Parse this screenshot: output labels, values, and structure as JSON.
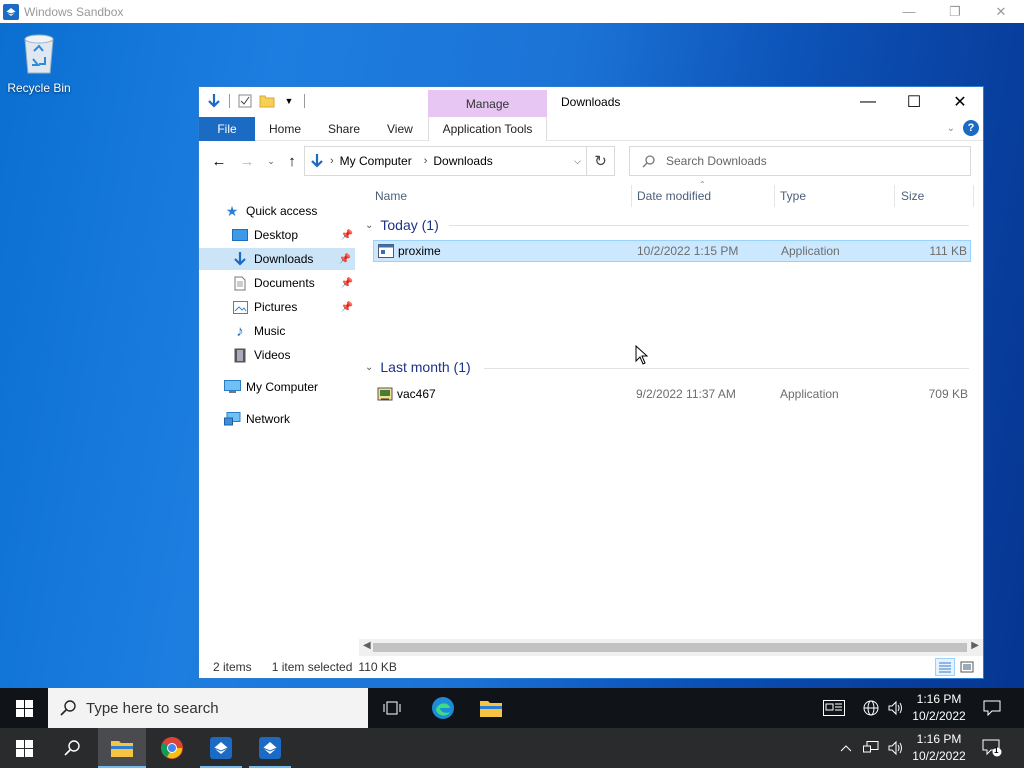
{
  "sandbox": {
    "title": "Windows Sandbox"
  },
  "desktop": {
    "recycle_bin_label": "Recycle Bin"
  },
  "explorer": {
    "title": "Downloads",
    "context_tab": "Manage",
    "ribbon_tabs": [
      "File",
      "Home",
      "Share",
      "View",
      "Application Tools"
    ],
    "breadcrumb": [
      "My Computer",
      "Downloads"
    ],
    "search_placeholder": "Search Downloads",
    "nav": {
      "quick_access": "Quick access",
      "items": [
        "Desktop",
        "Downloads",
        "Documents",
        "Pictures",
        "Music",
        "Videos"
      ],
      "my_computer": "My Computer",
      "network": "Network"
    },
    "columns": [
      "Name",
      "Date modified",
      "Type",
      "Size"
    ],
    "groups": [
      {
        "label": "Today (1)",
        "files": [
          {
            "name": "proxime",
            "date": "10/2/2022 1:15 PM",
            "type": "Application",
            "size": "111 KB",
            "selected": true
          }
        ]
      },
      {
        "label": "Last month (1)",
        "files": [
          {
            "name": "vac467",
            "date": "9/2/2022 11:37 AM",
            "type": "Application",
            "size": "709 KB",
            "selected": false
          }
        ]
      }
    ],
    "status": {
      "items": "2 items",
      "selected": "1 item selected",
      "size": "110 KB"
    }
  },
  "taskbar": {
    "search_placeholder": "Type here to search",
    "time": "1:16 PM",
    "date": "10/2/2022",
    "notification_count": "1"
  },
  "colors": {
    "accent": "#1b6ac4",
    "selection": "#cce8ff",
    "manage_tab": "#e8c6f3"
  }
}
